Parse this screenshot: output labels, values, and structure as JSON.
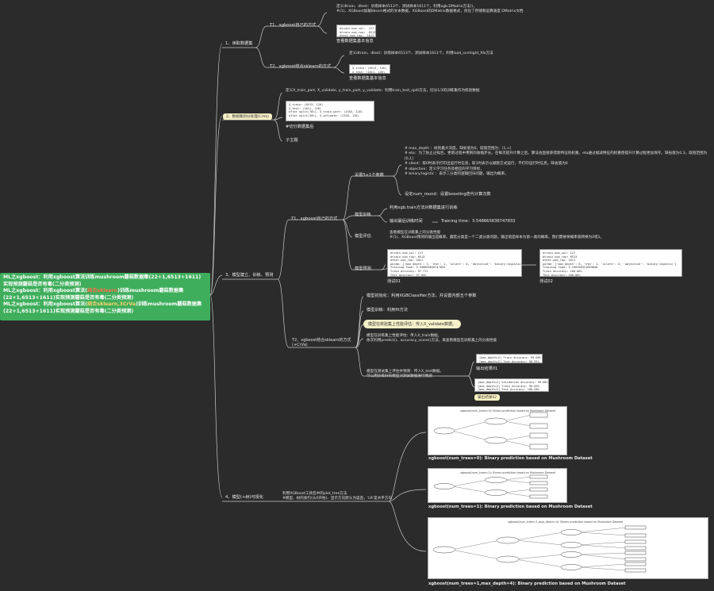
{
  "root": {
    "line1a": "ML之xgboost：利用xgboost算法训练mushroom蘑菇数据集(22+1,6513+1611)",
    "line1b": "实现预测蘑菇是否有毒(二分类预测)",
    "line2a": "ML之xgboost：利用xgboost算法(",
    "line2hl": "结合sklearn",
    "line2b": ")训练mushroom蘑菇数据集",
    "line2c": "(22+1,6513+1611)实现预测蘑菇是否有毒(二分类预测)",
    "line3a": "ML之xgboost：利用xgboost算法(",
    "line3hl": "结合sklearn,3CrVa",
    "line3b": ")训练mushroom蘑菇数据集",
    "line3c": "(22+1,6513+1611)实现预测蘑菇是否有毒(二分类预测)"
  },
  "b1": {
    "label": "1、读取数据集",
    "t1": {
      "label": "T1、xgboost自己的方式",
      "note": "定义dtrain、dtest：训练样本6513个、测试样本1611个。利用xgb.DMatrix方法()，\n#(1)、XGBoost加载libsvm格式的文本数据，XGBoost的DMatrix数据格式，优化了存储和运算速度 DMatrix文档",
      "code": "dtrain.num_col:  127\ndtrain.num_row:  6513\ndtest.num_row:  1611",
      "caption": "查看数据集基本信息"
    },
    "t2": {
      "label": "T2、xgboost结合sklearn的方式",
      "note": "定义dtrain、dtest：训练样本6513个、测试样本1611个。利用load_svmlight_file方法",
      "code": "X_train: (6513, 126)\nX_test: (1611, 126)",
      "caption": "查看数据集基本信息"
    }
  },
  "b2": {
    "label": "2、数据集划分处理(CrVa)",
    "note": "定义X_train_part, X_validate, y_train_part, y_validate：利用train_test_split方法，切分1/3的训练集作为校验数据",
    "code": "X_train: (6513, 126)\nX_test: (1611, 126)\nAfter split(70%), X_train_part: (4353, 126)\nAfter split(30%), X_validate: (2150, 126)",
    "caption": "#切分数据集后",
    "sub": "子主题"
  },
  "b3": {
    "label": "3、模型建立、训练、预测",
    "t1": {
      "label": "T1、xgboost自己的方式",
      "params": {
        "label": "设置5+1个参数",
        "note": "# max_depth ：树的最大深度。缺省值为6，取值范围为：[1,∞]\n# eta：为了防止过拟合，更新过程中用到的收缩步长。在每次提升计算之后，算法会直接获得新特征的权重。eta通过缩减特征的权重使提升计算过程更加保守。缺省值为0.3，取值范围为[0,1]\n# silent：取0时表示打印出运行时信息，取1时表示以缄默方式运行，不打印运行时信息。缺省值为0\n# objective：定义学习任务及相应的学习目标，\n# binary:logistic ：表示二分类的逻辑回归问题，输出为概率。",
        "round": "设定num_round：设置boosting迭代计算次数"
      },
      "train": {
        "label": "模型训练",
        "n1": "利用xgb.train方法对数据集进行训练",
        "n2": "输出最后训练时间",
        "time": "Training time：3.548665836747833"
      },
      "eval": {
        "label": "模型评估",
        "note": "查看模型在训练集上的分类性能\n#(1)、XGBoost预测的输出是概率。蘑菇分类是一个二类分类问题，输出值是样本为第一类的概率。我们需要将概率值转换为0或1。"
      },
      "pred": {
        "label": "模型预测",
        "code1": "dtrain.num_col: 127\ndtrain.num_row: 6513\ndtest.num_row: 1611\nparam: {'max_depth': 2, 'eta': 1, 'silent': 0, 'objective': 'binary:logistic'}\nTraining time: 3.548665836747833\nTrain Accuracy: 97.77%\nTest Accuracy: 97.83%",
        "cap1": "测试01",
        "code2": "dtrain.num_col: 127\ndtrain.num_row: 6513\ndtest.num_row: 1611\nparam: {'max_depth': 6, 'eta': 1, 'silent': 0, 'objective': 'binary:logistic'}\nTraining time: 5.190760321859848\nTrain Accuracy: 100.00%\nTest Accuracy: 100.00%",
        "cap2": "测试02"
      }
    },
    "t2": {
      "label": "T2、xgboost结合sklearn的方式\n(+CrVa)",
      "n1": "模型初始化：利用XGBClassifier方法，并设置内部五个参数",
      "n2": "模型训练：利用fit方法",
      "n3": "模型在校验集上性能评估：传入X_validate数据。",
      "n4": "模型在训练集上性能评估：传入X_train数据。\n依次利用predict()、accuracy_score()方法，来查看模型在训练集上的分类性能",
      "n5": "模型在测试集上评估并预测：传入X_test数据。\n可以用训练好的模型对测试数据进行预测",
      "code1": "[max_depth=2] Train Accuracy: 99.08%\n[max_depth=2] Test Accuracy: 98.95%",
      "cap1": "输出结果01",
      "code2": "[max_depth=2] Validation Accuracy: 99.08%\n[max_depth=2] Train Accuracy: 98.82%\n[max_depth=2] Test Accuracy: 100.00%",
      "cap2": "输出结果02"
    }
  },
  "b4": {
    "label": "4、模型(+树)可视化",
    "note": "利用XGBoost工具包中的plot_tree方法\n#模型、树的索引(从0开始)、显示方向默认为竖直，'LR'是水平方向",
    "tree1": {
      "title": "xgboost(num_trees=0): Binary prediction based on Mushroom Dataset",
      "caption": "xgboost(num_trees=0): Binary prediction based on Mushroom Dataset"
    },
    "tree2": {
      "title": "xgboost(num_trees=1): Binary prediction based on Mushroom Dataset",
      "caption": "xgboost(num_trees=1): Binary prediction based on Mushroom Dataset"
    },
    "tree3": {
      "title": "xgboost(num_trees=1,max_depth=4): Binary prediction based on Mushroom Dataset",
      "caption": "xgboost(num_trees=1,max_depth=4): Binary prediction based on Mushroom Dataset"
    }
  },
  "colors": {
    "background": "#2b2b2b",
    "root": "#3fae5c",
    "highlight": "#f3a53b",
    "line": "#c8c8c8"
  }
}
